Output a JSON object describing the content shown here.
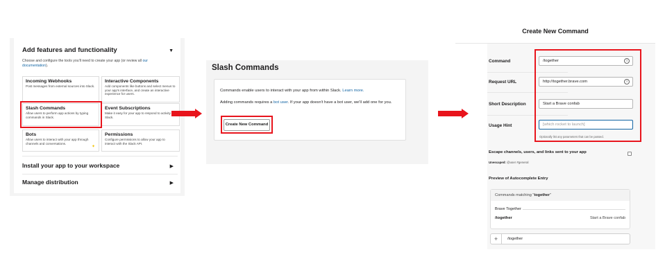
{
  "panel1": {
    "header": "Add features and functionality",
    "desc_prefix": "Choose and configure the tools you'll need to create your app (or review all ",
    "desc_link1": "our",
    "desc_link2": "documentation",
    "desc_suffix": ").",
    "features": [
      {
        "title": "Incoming Webhooks",
        "desc": "Post messages from external sources into Slack."
      },
      {
        "title": "Interactive Components",
        "desc": "Add components like buttons and select menus to your app's interface, and create an interactive experience for users."
      },
      {
        "title": "Slash Commands",
        "desc": "Allow users to perform app actions by typing commands in Slack."
      },
      {
        "title": "Event Subscriptions",
        "desc": "Make it easy for your app to respond to activity in Slack."
      },
      {
        "title": "Bots",
        "desc": "Allow users to interact with your app through channels and conversations."
      },
      {
        "title": "Permissions",
        "desc": "Configure permissions to allow your app to interact with the Slack API."
      }
    ],
    "sections": [
      "Install your app to your workspace",
      "Manage distribution"
    ],
    "caret_down": "▼",
    "caret_right": "▶"
  },
  "panel2": {
    "title": "Slash Commands",
    "text1": "Commands enable users to interact with your app from within Slack.",
    "learn_more": "Learn more.",
    "text2_prefix": "Adding commands requires a ",
    "bot_user": "bot user",
    "text2_suffix": ". If your app doesn't have a bot user, we'll add one for you.",
    "button": "Create New Command"
  },
  "panel3": {
    "title": "Create New Command",
    "fields": [
      {
        "label": "Command",
        "value": "/together"
      },
      {
        "label": "Request URL",
        "value": "http://together.brave.com"
      },
      {
        "label": "Short Description",
        "value": "Start a Brave confab"
      },
      {
        "label": "Usage Hint",
        "value": "[which rocket to launch]"
      }
    ],
    "hint": "Optionally list any parameters that can be passed.",
    "escape_label": "Escape channels, users, and links sent to your app",
    "unescaped_label": "Unescaped:",
    "unescaped_value": "@user #general",
    "preview_heading": "Preview of Autocomplete Entry",
    "matching_prefix": "Commands matching \"",
    "matching_term": "together",
    "matching_suffix": "\"",
    "app_name": "Brave Together",
    "cmd": "/together",
    "cmd_desc": "Start a Brave confab",
    "message_plus": "+",
    "message_text": "/together",
    "info_glyph": "i"
  },
  "colors": {
    "highlight": "#e8141c",
    "link": "#1264a3"
  },
  "icons": [
    "chevron-down-icon",
    "chevron-right-icon",
    "info-icon",
    "plus-icon",
    "arrow-right-icon",
    "sparkle-icon"
  ]
}
